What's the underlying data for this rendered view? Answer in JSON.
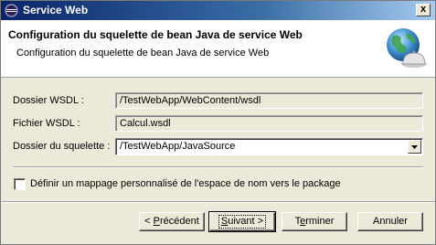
{
  "window": {
    "title": "Service Web",
    "close_label": "x"
  },
  "banner": {
    "heading": "Configuration du squelette de bean Java de service Web",
    "description": "Configuration du squelette de bean Java de service Web"
  },
  "form": {
    "wsdl_folder_label": "Dossier WSDL :",
    "wsdl_folder_value": "/TestWebApp/WebContent/wsdl",
    "wsdl_file_label": "Fichier WSDL :",
    "wsdl_file_value": "Calcul.wsdl",
    "skeleton_folder_label": "Dossier du squelette :",
    "skeleton_folder_value": "/TestWebApp/JavaSource"
  },
  "checkbox": {
    "label": "Définir un mappage personnalisé de l'espace de nom vers le package",
    "checked": false
  },
  "buttons": {
    "back_prefix": "< ",
    "back_mnemonic": "P",
    "back_rest": "récédent",
    "next_mnemonic": "S",
    "next_rest": "uivant >",
    "finish_prefix": "T",
    "finish_mnemonic": "e",
    "finish_rest": "rminer",
    "cancel": "Annuler"
  },
  "icons": {
    "app": "eclipse-icon",
    "banner": "globe-service-icon",
    "combo": "chevron-down-icon"
  }
}
